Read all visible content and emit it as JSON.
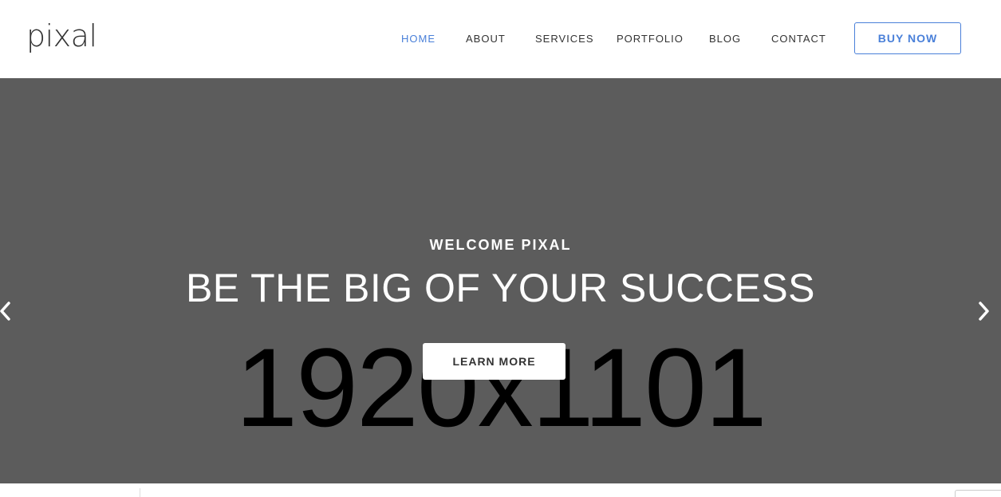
{
  "header": {
    "logo": "pixal",
    "nav": [
      {
        "label": "HOME",
        "active": true
      },
      {
        "label": "ABOUT",
        "active": false
      },
      {
        "label": "SERVICES",
        "active": false
      },
      {
        "label": "PORTFOLIO",
        "active": false
      },
      {
        "label": "BLOG",
        "active": false
      },
      {
        "label": "CONTACT",
        "active": false
      }
    ],
    "buy_label": "BUY NOW"
  },
  "hero": {
    "subtitle": "WELCOME PIXAL",
    "title": "BE THE BIG OF YOUR SUCCESS",
    "placeholder_text": "1920x1101",
    "learn_more_label": "LEARN MORE",
    "prev_icon": "chevron-left-icon",
    "next_icon": "chevron-right-icon"
  },
  "colors": {
    "accent": "#4a80d9",
    "hero_bg": "#5c5c5c",
    "nav_text": "#333333"
  }
}
